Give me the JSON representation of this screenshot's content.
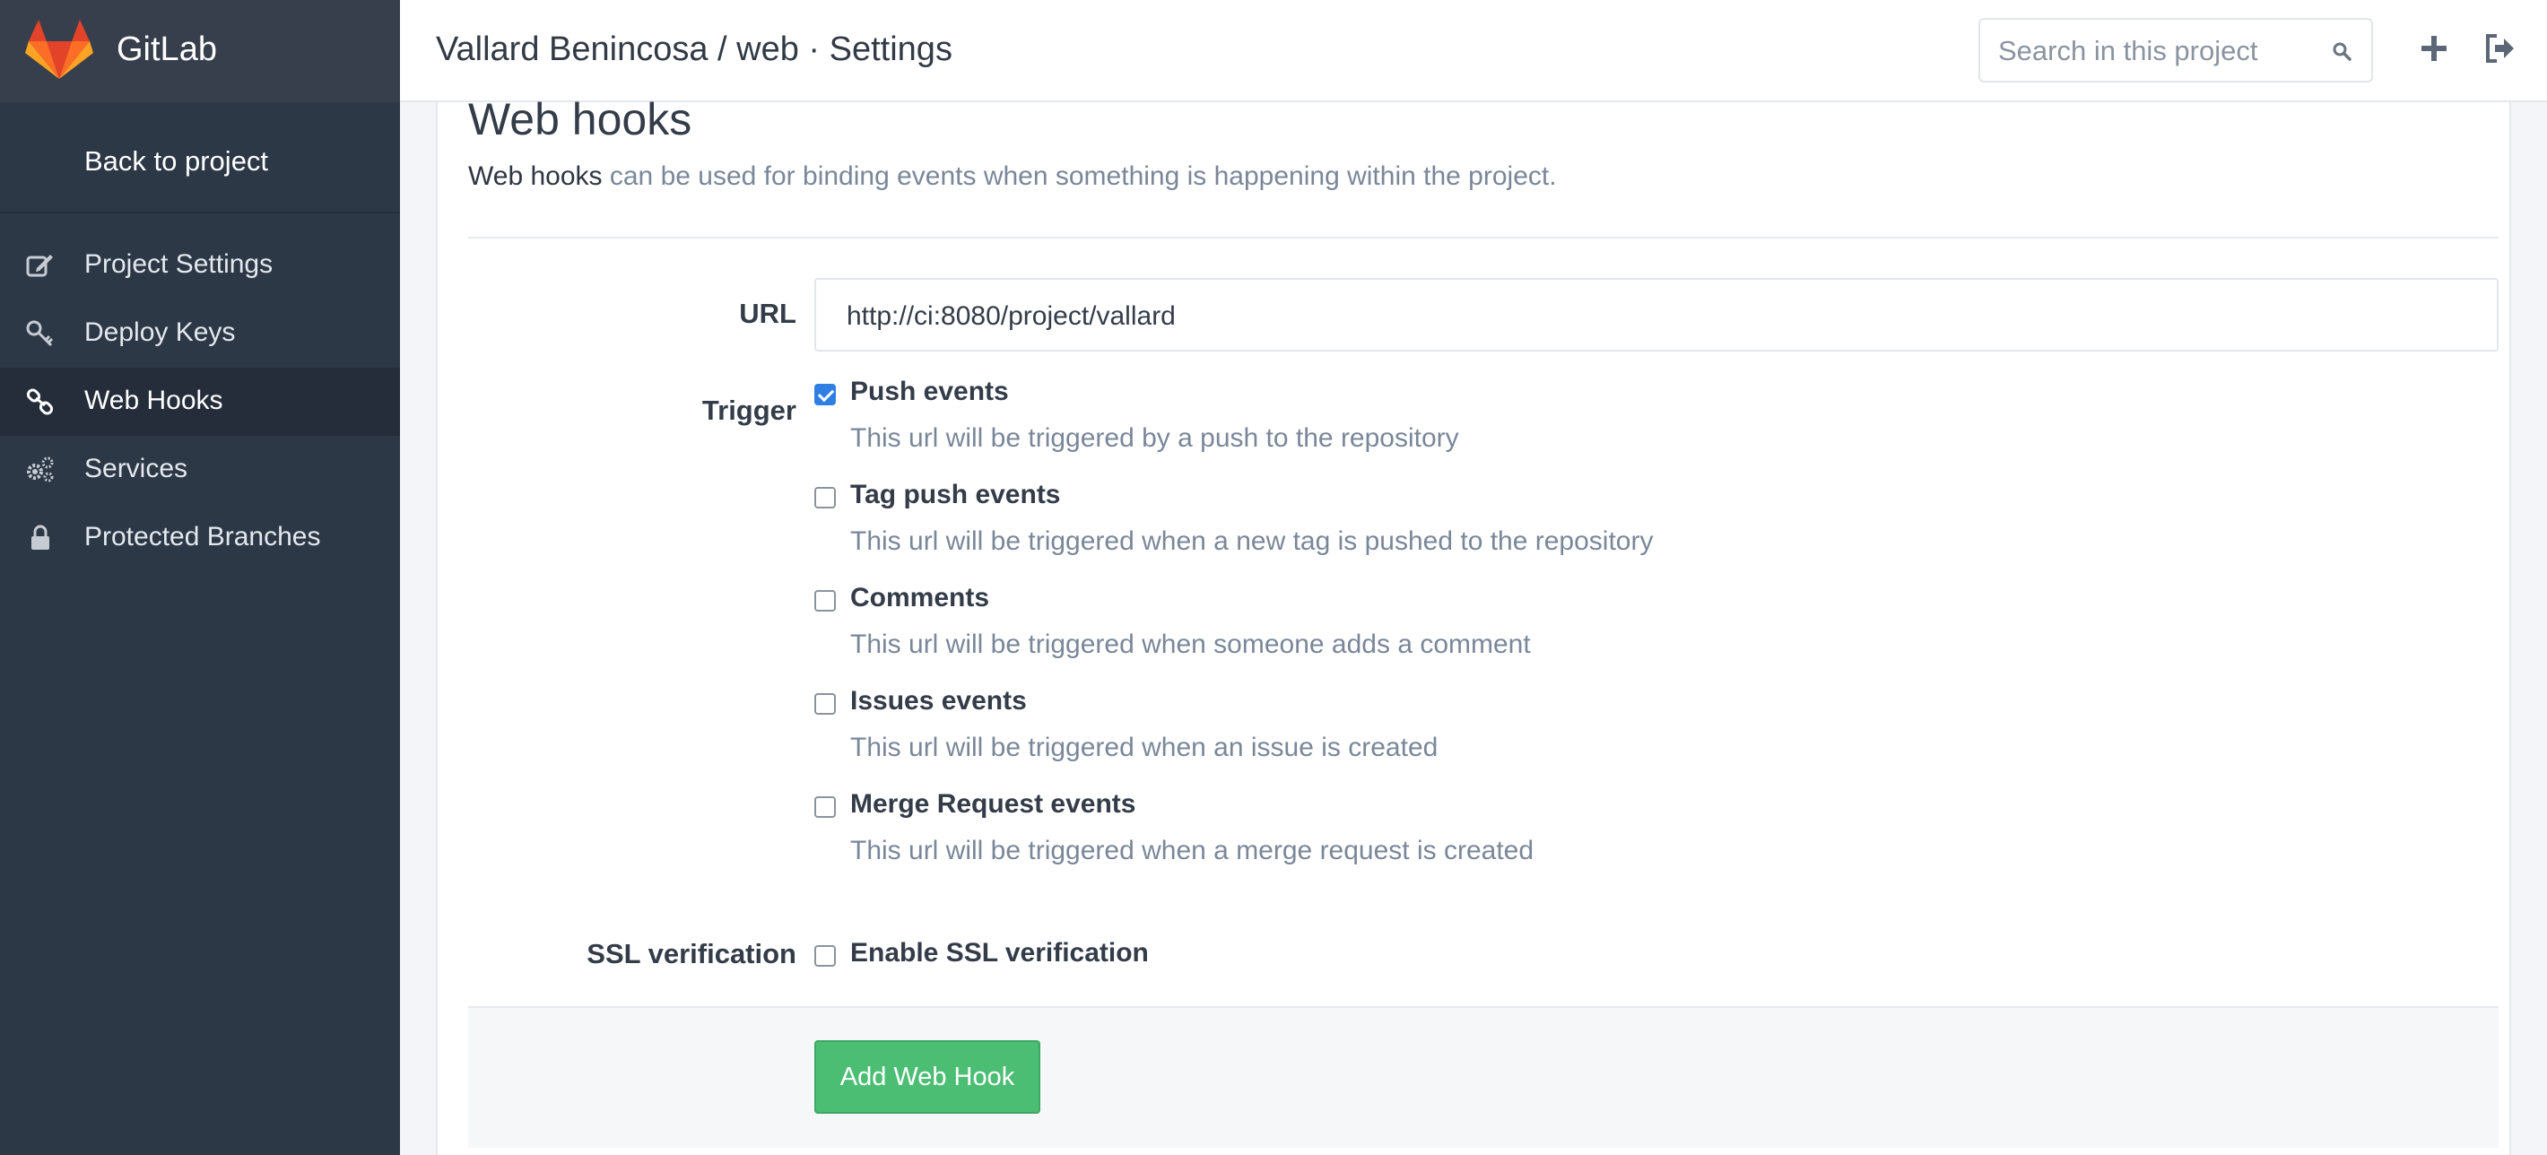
{
  "app": {
    "name": "GitLab",
    "logo_icon": "gitlab-fox-logo"
  },
  "sidebar": {
    "back_label": "Back to project",
    "items": [
      {
        "label": "Project Settings",
        "icon": "edit-icon",
        "active": false
      },
      {
        "label": "Deploy Keys",
        "icon": "key-icon",
        "active": false
      },
      {
        "label": "Web Hooks",
        "icon": "link-icon",
        "active": true
      },
      {
        "label": "Services",
        "icon": "cogs-icon",
        "active": false
      },
      {
        "label": "Protected Branches",
        "icon": "lock-icon",
        "active": false
      }
    ]
  },
  "header": {
    "breadcrumb": "Vallard Benincosa / web · Settings",
    "search_placeholder": "Search in this project"
  },
  "content": {
    "title": "Web hooks",
    "lead_strong": "Web hooks",
    "lead_rest": " can be used for binding events when something is happening within the project.",
    "url_label": "URL",
    "url_value": "http://ci:8080/project/vallard",
    "trigger_label": "Trigger",
    "triggers": [
      {
        "title": "Push events",
        "help": "This url will be triggered by a push to the repository",
        "checked": true
      },
      {
        "title": "Tag push events",
        "help": "This url will be triggered when a new tag is pushed to the repository",
        "checked": false
      },
      {
        "title": "Comments",
        "help": "This url will be triggered when someone adds a comment",
        "checked": false
      },
      {
        "title": "Issues events",
        "help": "This url will be triggered when an issue is created",
        "checked": false
      },
      {
        "title": "Merge Request events",
        "help": "This url will be triggered when a merge request is created",
        "checked": false
      }
    ],
    "ssl_label": "SSL verification",
    "ssl_option": "Enable SSL verification",
    "ssl_checked": false,
    "submit_label": "Add Web Hook"
  },
  "colors": {
    "sidebar_bg": "#2d3846",
    "accent_blue": "#2f7fe3",
    "success_green": "#4cbe73",
    "gitlab_orange": "#e24329"
  }
}
